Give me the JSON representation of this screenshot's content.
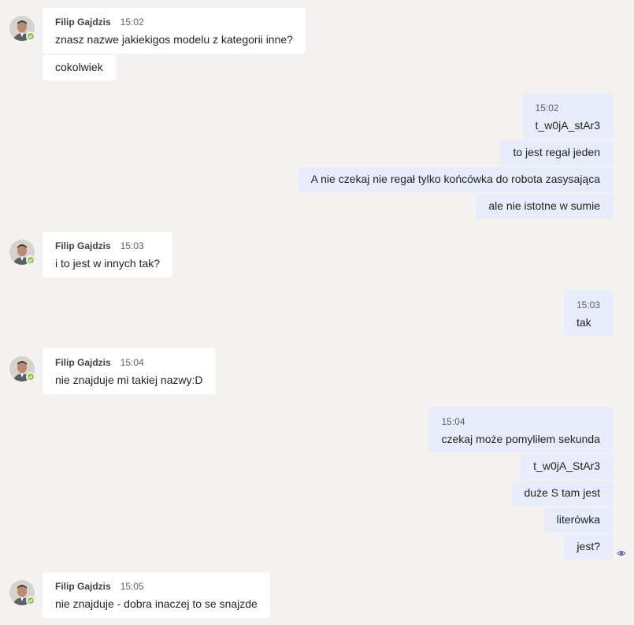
{
  "colors": {
    "background": "#f3f2f1",
    "incoming_bubble": "#ffffff",
    "outgoing_bubble": "#e8ebfa",
    "presence_available": "#92c353",
    "seen_indicator": "#6264a7"
  },
  "messages": {
    "m1": {
      "sender": "Filip Gajdzis",
      "time": "15:02",
      "text": "znasz nazwe jakiekigos modelu z kategorii inne?"
    },
    "m1b": {
      "text": "cokolwiek"
    },
    "m2": {
      "time": "15:02",
      "text": "t_w0jA_stAr3"
    },
    "m2b": {
      "text": "to jest regał jeden"
    },
    "m2c": {
      "text": "A nie czekaj nie regał tylko końcówka do robota zasysająca"
    },
    "m2d": {
      "text": "ale nie istotne w sumie"
    },
    "m3": {
      "sender": "Filip Gajdzis",
      "time": "15:03",
      "text": "i to jest w innych tak?"
    },
    "m4": {
      "time": "15:03",
      "text": "tak"
    },
    "m5": {
      "sender": "Filip Gajdzis",
      "time": "15:04",
      "text": "nie znajduje mi takiej nazwy:D"
    },
    "m6": {
      "time": "15:04",
      "text": "czekaj może pomyliłem sekunda"
    },
    "m6b": {
      "text": "t_w0jA_StAr3"
    },
    "m6c": {
      "text": "duże S tam jest"
    },
    "m6d": {
      "text": "literówka"
    },
    "m6e": {
      "text": "jest?"
    },
    "m7": {
      "sender": "Filip Gajdzis",
      "time": "15:05",
      "text": "nie znajduje - dobra inaczej to se snajzde"
    }
  },
  "icons": {
    "avatar": "user-avatar-photo",
    "presence": "available-check-icon",
    "seen": "seen-eye-icon"
  }
}
